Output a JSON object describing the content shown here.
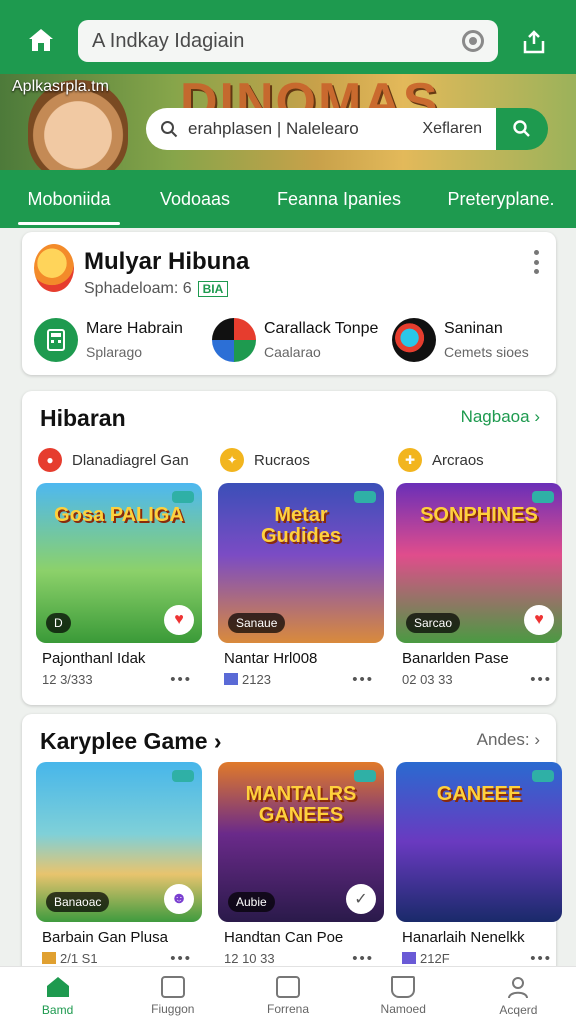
{
  "colors": {
    "brand": "#1e9a4f",
    "accent_red": "#e63d2e",
    "text": "#111111"
  },
  "topbar": {
    "home_icon": "home-icon",
    "search_value": "A Indkay Idagiain",
    "scan_icon": "scan-icon",
    "share_icon": "share-icon"
  },
  "hero": {
    "site_label": "Aplkasrpla.tm",
    "banner_title": "DINOMAS",
    "search_query": "erahplasen | Nalelearo",
    "search_filter": "Xeflaren",
    "search_icon": "search-icon"
  },
  "tabs": [
    {
      "label": "Moboniida",
      "active": true
    },
    {
      "label": "Vodoaas",
      "active": false
    },
    {
      "label": "Feanna Ipanies",
      "active": false
    },
    {
      "label": "Preteryplane.",
      "active": false
    }
  ],
  "profile": {
    "name": "Mulyar Hibuna",
    "subtitle": "Sphadeloam: 6",
    "badge": "BIA",
    "items": [
      {
        "title": "Mare Habrain",
        "sub": "Splarago"
      },
      {
        "title": "Carallack Tonpe",
        "sub": "Caalarao"
      },
      {
        "title": "Saninan",
        "sub": "Cemets sioes"
      }
    ]
  },
  "section1": {
    "title": "Hibaran",
    "link": "Nagbaoa",
    "chips": [
      "Dlanadiagrel Gan",
      "Rucraos",
      "Arcraos"
    ],
    "games": [
      {
        "art": "Gosa PALIGA",
        "tag": "D",
        "name": "Pajonthanl Idak",
        "meta": "12 3/333"
      },
      {
        "art": "Metar Gudides",
        "tag": "Sanaue",
        "name": "Nantar Hrl008",
        "meta": "2123"
      },
      {
        "art": "SONPHINES",
        "tag": "Sarcao",
        "name": "Banarlden Pase",
        "meta": "02 03 33"
      }
    ]
  },
  "section2": {
    "title": "Karyplee Game",
    "link": "Andes:",
    "games": [
      {
        "art": "",
        "tag": "Banaoac",
        "name": "Barbain Gan Plusa",
        "meta": "2/1 S1"
      },
      {
        "art": "MANTALRS GANEES",
        "tag": "Aubie",
        "name": "Handtan Can Poe",
        "meta": "12 10 33"
      },
      {
        "art": "GANEEE",
        "tag": "",
        "name": "Hanarlaih Nenelkk",
        "meta": "212F"
      }
    ]
  },
  "bottom_nav": [
    {
      "label": "Bamd",
      "icon": "home-icon",
      "active": true
    },
    {
      "label": "Fiuggon",
      "icon": "square-icon",
      "active": false
    },
    {
      "label": "Forrena",
      "icon": "gamepad-icon",
      "active": false
    },
    {
      "label": "Namoed",
      "icon": "book-icon",
      "active": false
    },
    {
      "label": "Acqerd",
      "icon": "user-icon",
      "active": false
    }
  ]
}
